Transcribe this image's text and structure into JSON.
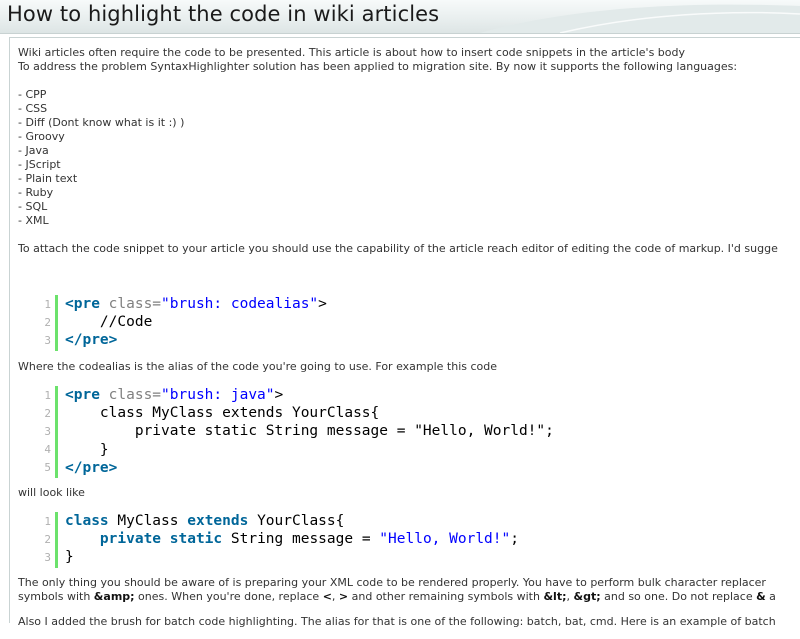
{
  "page": {
    "title": "How to highlight the code in wiki articles"
  },
  "intro": {
    "line1": "Wiki articles often require the code to be presented. This article is about how to insert code snippets in the article's body",
    "line2": "To address the problem SyntaxHighlighter solution has been applied to migration site. By now it supports the following languages:"
  },
  "languages": [
    "- CPP",
    "- CSS",
    "- Diff (Dont know what is it :) )",
    "- Groovy",
    "- Java",
    "- JScript",
    "- Plain text",
    "- Ruby",
    "- SQL",
    "- XML"
  ],
  "attach_text": "To attach the code snippet to your article you should use the capability of the article reach editor of editing the code of markup. I'd sugge",
  "snippet1": {
    "line_numbers": [
      "1",
      "2",
      "3"
    ],
    "l1_open": "<pre",
    "l1_attr": " class=",
    "l1_val": "\"brush: codealias\"",
    "l1_close": ">",
    "l2": "    //Code",
    "l3": "</pre>"
  },
  "codealias_text": "Where the codealias is the alias of the code you're going to use. For example this code",
  "snippet2": {
    "line_numbers": [
      "1",
      "2",
      "3",
      "4",
      "5"
    ],
    "l1_open": "<pre",
    "l1_attr": " class=",
    "l1_val": "\"brush: java\"",
    "l1_close": ">",
    "l2": "    class MyClass extends YourClass{",
    "l3": "        private static String message = \"Hello, World!\";",
    "l4": "    }",
    "l5": "</pre>"
  },
  "look_like_text": "will look like",
  "snippet3": {
    "line_numbers": [
      "1",
      "2",
      "3"
    ],
    "l1_kw1": "class",
    "l1_t1": " MyClass ",
    "l1_kw2": "extends",
    "l1_t2": " YourClass{",
    "l2_indent": "    ",
    "l2_kw1": "private",
    "l2_sp": " ",
    "l2_kw2": "static",
    "l2_t1": " String message = ",
    "l2_str": "\"Hello, World!\"",
    "l2_end": ";",
    "l3": "}"
  },
  "aware": {
    "line1": "The only thing you should be aware of is preparing your XML code to be rendered properly. You have to perform bulk character replacer",
    "l2_a": "symbols with ",
    "l2_b": "&amp;",
    "l2_c": " ones. When you're done, replace ",
    "l2_d": "<",
    "l2_e": ", ",
    "l2_f": ">",
    "l2_g": " and other remaining symbols with ",
    "l2_h": "&lt;",
    "l2_i": ", ",
    "l2_j": "&gt;",
    "l2_k": " and so one. Do not replace ",
    "l2_l": "&",
    "l2_m": " a"
  },
  "batch_text": "Also I added the brush for batch code highlighting. The alias for that is one of the following: batch, bat, cmd. Here is an example of batch"
}
